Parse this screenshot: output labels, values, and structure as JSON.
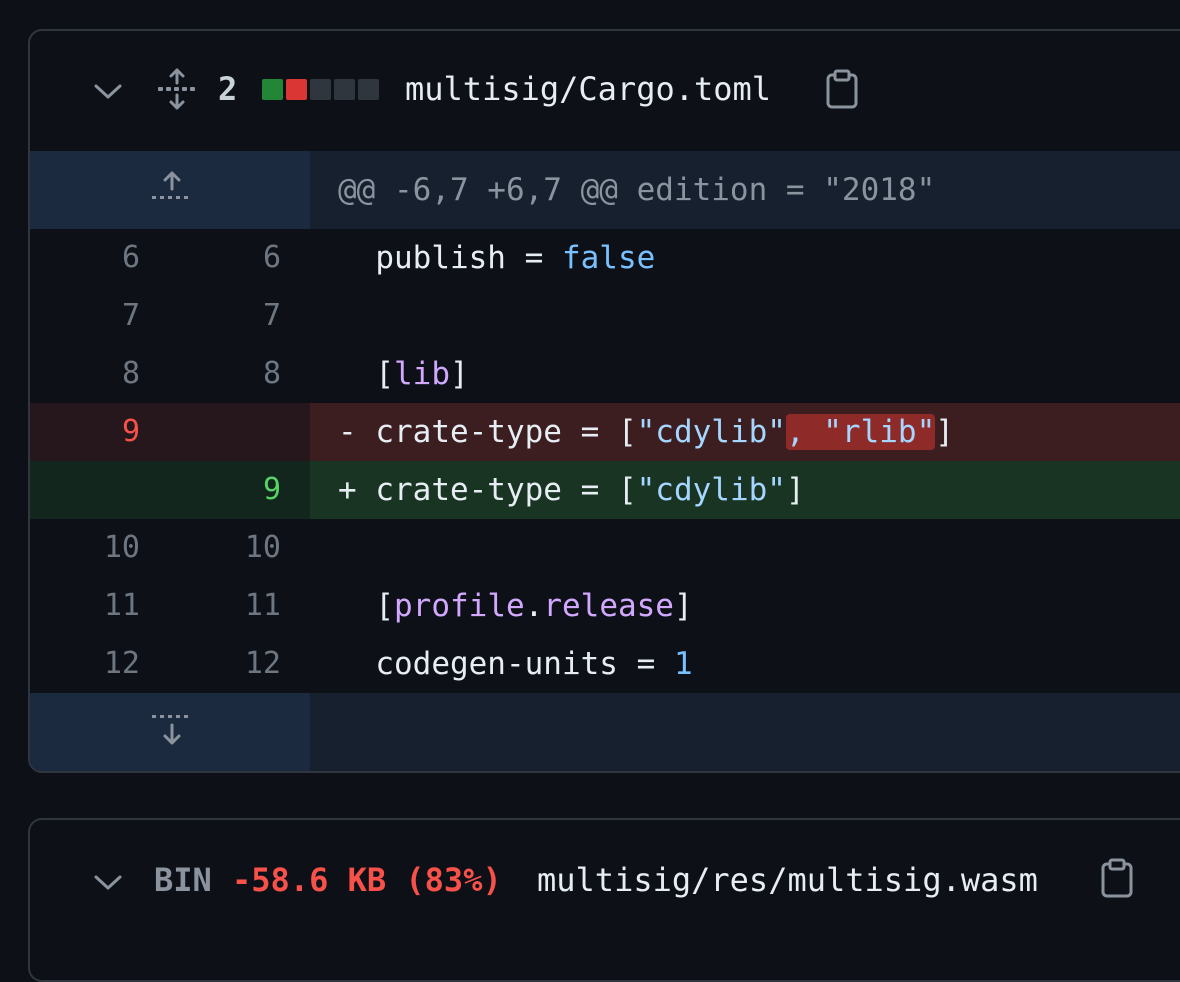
{
  "files": [
    {
      "changes": "2",
      "filename": "multisig/Cargo.toml",
      "diffstat_colors": [
        "#238636",
        "#da3633",
        "#30363d",
        "#30363d",
        "#30363d"
      ],
      "hunk_header": "@@ -6,7 +6,7 @@ edition = \"2018\"",
      "lines": [
        {
          "old": "6",
          "new": "6",
          "sign": " ",
          "tokens": [
            {
              "t": "publish = ",
              "c": "k-key"
            },
            {
              "t": "false",
              "c": "k-bool"
            }
          ]
        },
        {
          "old": "7",
          "new": "7",
          "sign": " ",
          "tokens": []
        },
        {
          "old": "8",
          "new": "8",
          "sign": " ",
          "tokens": [
            {
              "t": "[",
              "c": "k-key"
            },
            {
              "t": "lib",
              "c": "k-sec"
            },
            {
              "t": "]",
              "c": "k-key"
            }
          ]
        },
        {
          "old": "9",
          "new": "",
          "sign": "-",
          "tokens": [
            {
              "t": "crate-type = [",
              "c": "k-key"
            },
            {
              "t": "\"cdylib\"",
              "c": "k-str"
            },
            {
              "t": ", \"rlib\"",
              "c": "k-str hl-del"
            },
            {
              "t": "]",
              "c": "k-key"
            }
          ]
        },
        {
          "old": "",
          "new": "9",
          "sign": "+",
          "tokens": [
            {
              "t": "crate-type = [",
              "c": "k-key"
            },
            {
              "t": "\"cdylib\"",
              "c": "k-str"
            },
            {
              "t": "]",
              "c": "k-key"
            }
          ]
        },
        {
          "old": "10",
          "new": "10",
          "sign": " ",
          "tokens": []
        },
        {
          "old": "11",
          "new": "11",
          "sign": " ",
          "tokens": [
            {
              "t": "[",
              "c": "k-key"
            },
            {
              "t": "profile",
              "c": "k-sec"
            },
            {
              "t": ".",
              "c": "k-key"
            },
            {
              "t": "release",
              "c": "k-sec"
            },
            {
              "t": "]",
              "c": "k-key"
            }
          ]
        },
        {
          "old": "12",
          "new": "12",
          "sign": " ",
          "tokens": [
            {
              "t": "codegen-units = ",
              "c": "k-key"
            },
            {
              "t": "1",
              "c": "k-num"
            }
          ]
        }
      ]
    },
    {
      "bin_label": "BIN",
      "size_change": "-58.6 KB (83%)",
      "filename": "multisig/res/multisig.wasm"
    }
  ],
  "icons": {
    "collapse": "chevron-down-icon",
    "expand_all": "unfold-icon",
    "copy": "copy-icon",
    "expand_up": "fold-up-icon",
    "expand_down": "fold-down-icon"
  }
}
